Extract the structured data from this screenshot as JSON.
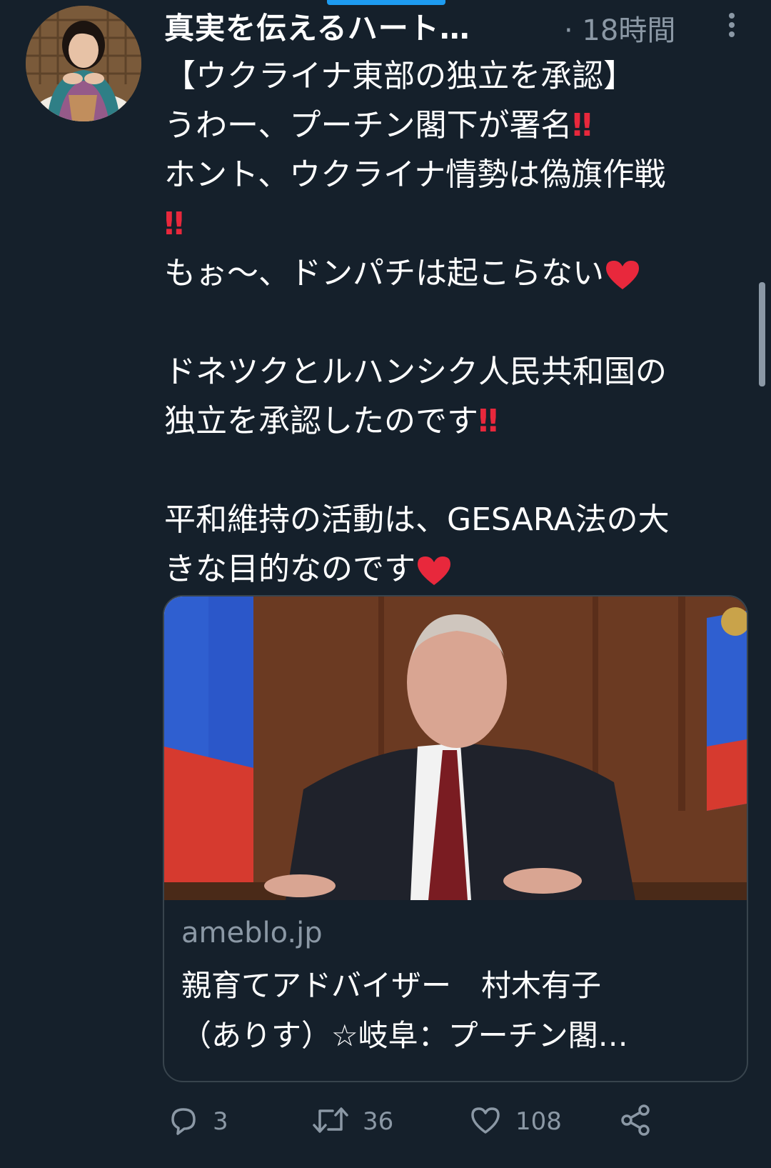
{
  "tweet": {
    "author_name": "真実を伝えるハート…",
    "time": "· 18時間",
    "text_lines": [
      {
        "text": "【ウクライナ東部の独立を承認】",
        "suffix": ""
      },
      {
        "text": "うわー、プーチン閣下が署名",
        "suffix": "bangbang"
      },
      {
        "text": "ホント、ウクライナ情勢は偽旗作戦",
        "suffix": ""
      },
      {
        "text": "",
        "suffix": "bangbang"
      },
      {
        "text": "もぉ〜、ドンパチは起こらない",
        "suffix": "heart"
      },
      {
        "text": "",
        "suffix": "blank"
      },
      {
        "text": "ドネツクとルハンシク人民共和国の",
        "suffix": ""
      },
      {
        "text": "独立を承認したのです",
        "suffix": "bangbang"
      },
      {
        "text": "",
        "suffix": "blank"
      },
      {
        "text": "平和維持の活動は、GESARA法の大",
        "suffix": ""
      },
      {
        "text": "きな目的なのです",
        "suffix": "heart"
      }
    ],
    "bangbang_glyph": "‼",
    "card": {
      "domain": "ameblo.jp",
      "title_line1": "親育てアドバイザー　村木有子",
      "title_line2": "（ありす）☆岐阜：プーチン閣…"
    },
    "actions": {
      "reply_count": "3",
      "retweet_count": "36",
      "like_count": "108"
    },
    "icons": {
      "more": "more-vertical-icon",
      "reply": "reply-icon",
      "retweet": "retweet-icon",
      "like": "heart-outline-icon",
      "share": "share-icon"
    },
    "colors": {
      "background": "#15202b",
      "secondary_text": "#8b98a5",
      "accent": "#1d9bf0",
      "emoji_red": "#e8283c"
    }
  }
}
